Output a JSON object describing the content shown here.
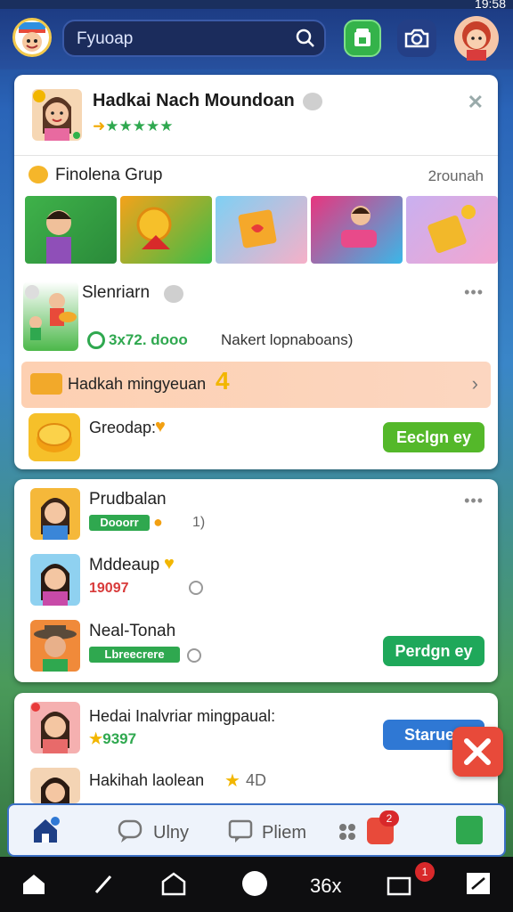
{
  "status": {
    "time": "19:58"
  },
  "header": {
    "search_placeholder": "Fyuoap"
  },
  "profile": {
    "name": "Hadkai Nach Moundoan",
    "stars": "★★★★★"
  },
  "group": {
    "title": "Finolena Grup",
    "action": "2rounah"
  },
  "post": {
    "author": "Slenriarn",
    "stats": "3x72. dooo",
    "stats_suffix": "Nakert lopnaboans)"
  },
  "promo": {
    "text": "Hadkah mingyeuan",
    "reward_label": "Greodap:",
    "reward_button": "Eeclgn ey"
  },
  "friends": [
    {
      "name": "Prudbalan",
      "badge": "Dooorr",
      "extra": "1)"
    },
    {
      "name": "Mddeaup",
      "badge": "19097"
    },
    {
      "name": "Neal-Tonah",
      "badge": "Lbreecrere",
      "button": "Perdgn ey"
    }
  ],
  "requests": [
    {
      "name": "Hedai Inalvriar mingpaual:",
      "points": "9397",
      "button": "Staruee"
    },
    {
      "name": "Hakihah laolean",
      "points": "4D"
    }
  ],
  "bottom_nav": {
    "tab2": "Ulny",
    "tab3": "Pliem",
    "notif_count": "2"
  },
  "system_nav": {
    "center": "36x",
    "notif": "1"
  },
  "colors": {
    "accent_green": "#2fa84f",
    "accent_blue": "#2f78d4",
    "primary_bg": "#27509e",
    "banner": "#fdd0b2"
  }
}
